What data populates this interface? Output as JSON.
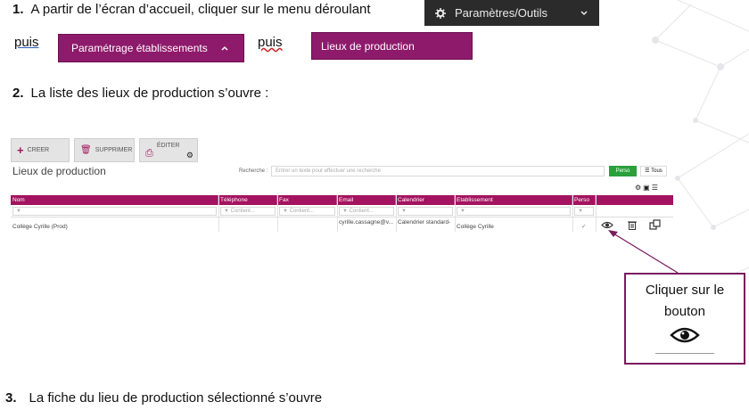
{
  "step1": {
    "number": "1.",
    "text": "A partir de l’écran d’accueil, cliquer sur le menu déroulant",
    "menu_label": "Paramètres/Outils",
    "puis1": "puis",
    "btn_etablissements": "Paramétrage établissements",
    "puis2": "puis",
    "btn_lieux": "Lieux de production"
  },
  "step2": {
    "number": "2.",
    "text": "La liste des lieux de production s’ouvre :"
  },
  "screenshot": {
    "toolbar": {
      "create": "CREER",
      "delete": "SUPPRIMER",
      "edit": "ÉDITER"
    },
    "title": "Lieux de production",
    "search_label": "Recherche :",
    "search_placeholder": "Entrer un texte pour effectuer une recherche",
    "perso_btn": "Perso",
    "tous_btn": "Tous",
    "columns": [
      "Nom",
      "Téléphone",
      "Fax",
      "Email",
      "Calendrier",
      "Etablissement",
      "Perso"
    ],
    "filter_placeholder": "Contient...",
    "row": {
      "nom": "Collège Cyrille (Prod)",
      "email": "cyrille.cassagne@v...",
      "calendrier": "Calendrier standard-",
      "etablissement": "Collège Cyrille",
      "perso": "✓"
    }
  },
  "callout": {
    "line1": "Cliquer sur le",
    "line2": "bouton"
  },
  "step3": {
    "number": "3.",
    "text": "La fiche du lieu de production sélectionné s’ouvre"
  },
  "colors": {
    "purple": "#8e1a6b",
    "header": "#a3135f",
    "dark": "#2b2b2b",
    "arrow": "#7a1a5e"
  }
}
